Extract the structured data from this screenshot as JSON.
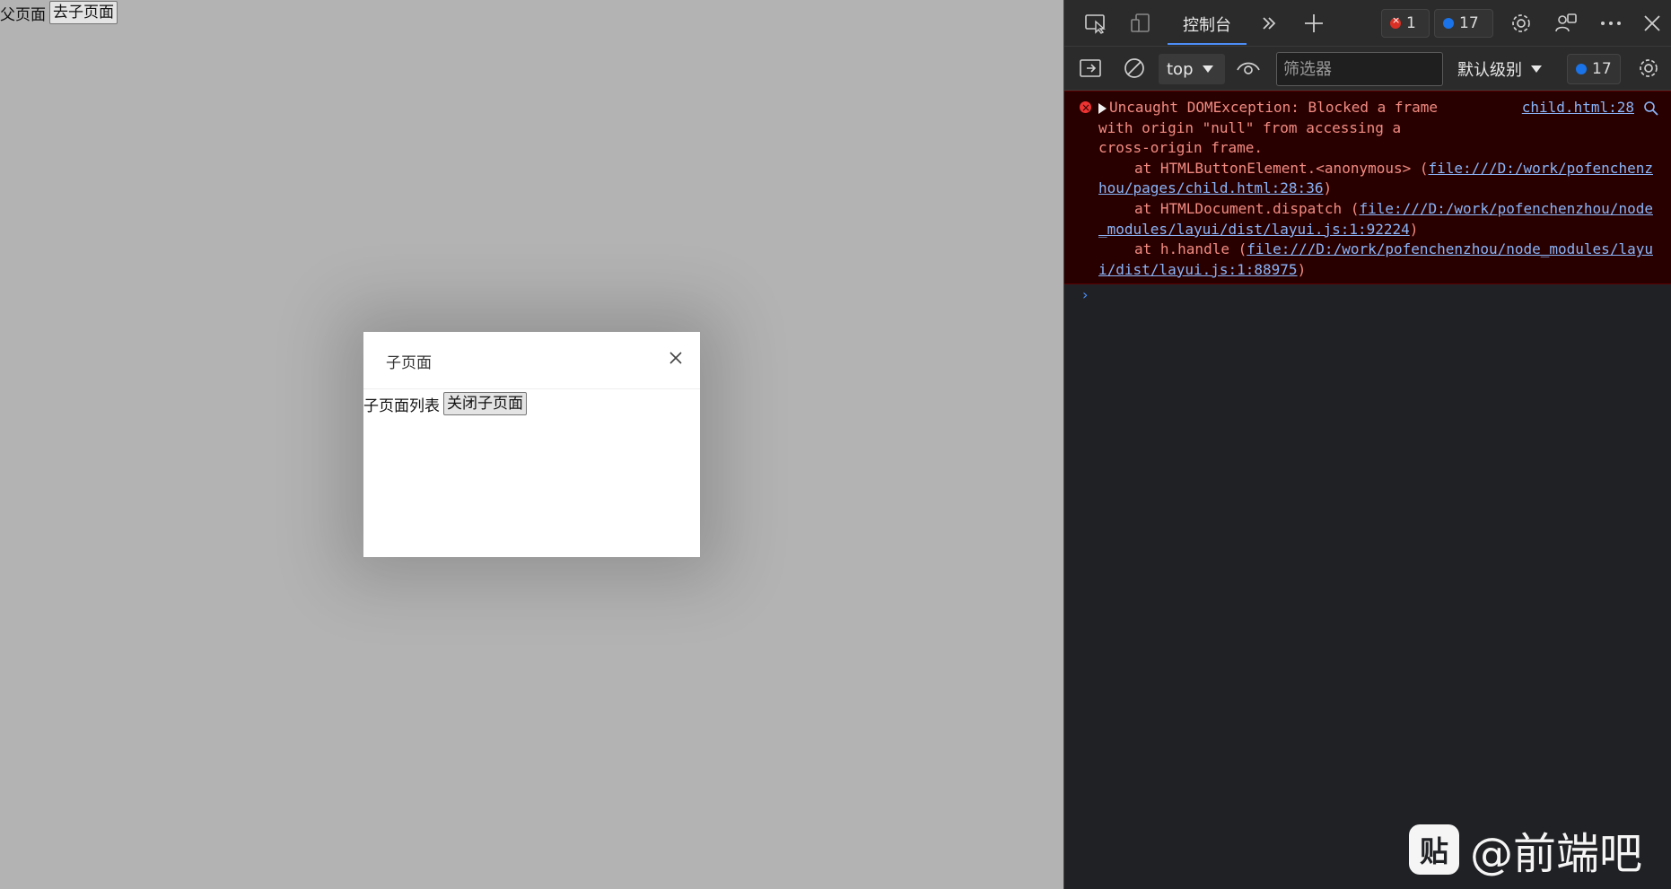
{
  "left_page": {
    "parent_label": "父页面",
    "goto_child_button": "去子页面",
    "popup": {
      "title": "子页面",
      "list_label": "子页面列表",
      "close_child_button": "关闭子页面"
    }
  },
  "devtools": {
    "tab_console": "控制台",
    "error_count": "1",
    "issue_count": "17",
    "context": "top",
    "filter_placeholder": "筛选器",
    "levels": "默认级别",
    "issues_badge": "17",
    "error": {
      "message_part1": "Uncaught DOMException: Blocked a frame",
      "message_part2": "with origin \"null\" from accessing a",
      "message_part3": "cross-origin frame.",
      "source_link": "child.html:28",
      "frames": [
        {
          "prefix": "at HTMLButtonElement.<anonymous> (",
          "link": "file:///D:/work/pofenchenzhou/pages/child.html:28:36",
          "suffix": ")"
        },
        {
          "prefix": "at HTMLDocument.dispatch (",
          "link": "file:///D:/work/pofenchenzhou/node_modules/layui/dist/layui.js:1:92224",
          "suffix": ")"
        },
        {
          "prefix": "at h.handle (",
          "link": "file:///D:/work/pofenchenzhou/node_modules/layui/dist/layui.js:1:88975",
          "suffix": ")"
        }
      ]
    },
    "prompt_symbol": "›"
  },
  "watermark": {
    "logo_text": "贴",
    "text": "@前端吧"
  },
  "colors": {
    "page_bg": "#b3b3b3",
    "devtools_bg": "#202124",
    "error_bg": "#290000",
    "error_text": "#f28b82",
    "link": "#8ab4f8",
    "accent": "#4c8df6"
  }
}
